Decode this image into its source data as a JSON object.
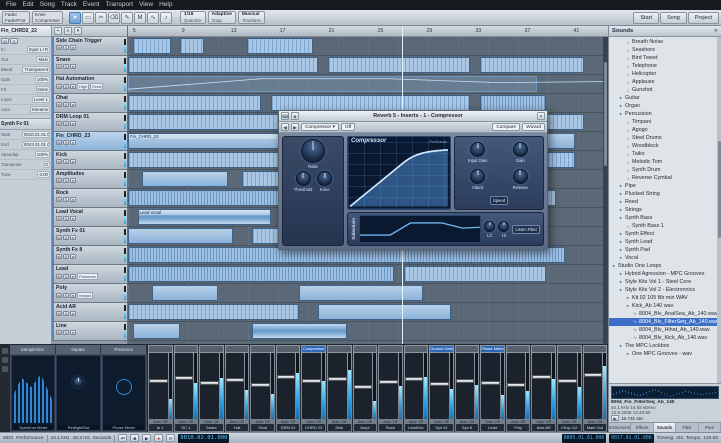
{
  "menubar": {
    "items": [
      "File",
      "Edit",
      "Song",
      "Track",
      "Event",
      "Transport",
      "View",
      "Help"
    ]
  },
  "linkboxes": [
    {
      "line1": "Fader",
      "line2": "FaderPort"
    },
    {
      "line1": "Knee",
      "line2": "Compressor"
    }
  ],
  "toolbar": {
    "tools": [
      {
        "name": "arrow-tool",
        "glyph": "➤"
      },
      {
        "name": "range-tool",
        "glyph": "▭"
      },
      {
        "name": "split-tool",
        "glyph": "✂"
      },
      {
        "name": "eraser-tool",
        "glyph": "⌫"
      },
      {
        "name": "paint-tool",
        "glyph": "✎"
      },
      {
        "name": "mute-tool",
        "glyph": "M"
      },
      {
        "name": "bend-tool",
        "glyph": "∿"
      },
      {
        "name": "listen-tool",
        "glyph": "♪"
      }
    ],
    "boxes": [
      {
        "top": "1/16",
        "bottom": "Quantize"
      },
      {
        "top": "Adaptive",
        "bottom": "Snap"
      },
      {
        "top": "Musical",
        "bottom": "Timebase"
      }
    ],
    "right_buttons": [
      "Start",
      "Song",
      "Project"
    ]
  },
  "inspector": {
    "track_name": "Fin_CHRD2_22",
    "buttons": [
      "M",
      "S"
    ],
    "rows": [
      {
        "label": "In",
        "value": "Input L+R"
      },
      {
        "label": "Out",
        "value": "Main"
      },
      {
        "label": "Blend",
        "value": "Transparent"
      },
      {
        "label": "Gain",
        "value": "100%"
      },
      {
        "label": "FX",
        "value": "None"
      },
      {
        "label": "Layer",
        "value": "Level 1"
      },
      {
        "label": "Auto",
        "value": "Streams"
      }
    ],
    "section2": {
      "title": "Synth Fx 01",
      "rows": [
        {
          "label": "Start",
          "value": "0010.01.01.000"
        },
        {
          "label": "End",
          "value": "0043.01.01.000"
        },
        {
          "label": "Speedup",
          "value": "100%"
        },
        {
          "label": "Transpose",
          "value": "0"
        },
        {
          "label": "Tune",
          "value": "0.00"
        }
      ]
    }
  },
  "tracks": [
    {
      "name": "Side Chain Trigger"
    },
    {
      "name": "Snare"
    },
    {
      "name": "Hat Automation",
      "chips": [
        "High",
        "Feed"
      ]
    },
    {
      "name": "Ohat"
    },
    {
      "name": "DRM Loop 01"
    },
    {
      "name": "Fin_CHRD_23",
      "selected": true
    },
    {
      "name": "Kick"
    },
    {
      "name": "Amplitudes"
    },
    {
      "name": "Rock"
    },
    {
      "name": "Lead Vocal"
    },
    {
      "name": "Synth Fx 01"
    },
    {
      "name": "Synth Fx 8"
    },
    {
      "name": "Lead",
      "sub": "Presence"
    },
    {
      "name": "Poly",
      "sub": "Impact"
    },
    {
      "name": "Acid AR"
    },
    {
      "name": "Line"
    }
  ],
  "arrange": {
    "ruler": [
      "5",
      "9",
      "13",
      "17",
      "21",
      "25",
      "29",
      "33",
      "37",
      "41"
    ],
    "rows": [
      {
        "clips": [
          {
            "x": 1,
            "w": 8,
            "t": "steps"
          },
          {
            "x": 11,
            "w": 5,
            "t": "steps"
          },
          {
            "x": 25,
            "w": 14,
            "t": "steps"
          }
        ]
      },
      {
        "clips": [
          {
            "x": 0,
            "w": 40,
            "t": "steps"
          },
          {
            "x": 42,
            "w": 30,
            "t": "steps"
          },
          {
            "x": 74,
            "w": 22,
            "t": "steps"
          }
        ]
      },
      {
        "auto": true,
        "clips": [
          {
            "x": 0,
            "w": 86,
            "t": "ghost"
          }
        ]
      },
      {
        "clips": [
          {
            "x": 0,
            "w": 28,
            "t": "steps"
          },
          {
            "x": 30,
            "w": 42,
            "t": "steps"
          },
          {
            "x": 74,
            "w": 14,
            "t": "cells"
          }
        ]
      },
      {
        "clips": [
          {
            "x": 0,
            "w": 96,
            "t": "steps"
          }
        ]
      },
      {
        "clips": [
          {
            "x": 0,
            "w": 58,
            "t": "solid",
            "label": "Fin_CHRD_23"
          },
          {
            "x": 60,
            "w": 34,
            "t": "solid"
          }
        ]
      },
      {
        "clips": [
          {
            "x": 0,
            "w": 42,
            "t": "steps"
          },
          {
            "x": 46,
            "w": 48,
            "t": "steps"
          }
        ]
      },
      {
        "clips": [
          {
            "x": 3,
            "w": 18,
            "t": "solid"
          },
          {
            "x": 24,
            "w": 30,
            "t": "steps"
          },
          {
            "x": 58,
            "w": 20,
            "t": "solid"
          }
        ]
      },
      {
        "clips": [
          {
            "x": 0,
            "w": 48,
            "t": "cells"
          },
          {
            "x": 50,
            "w": 40,
            "t": "steps"
          }
        ]
      },
      {
        "clips": [
          {
            "x": 2,
            "w": 28,
            "t": "wave",
            "label": "Lead Vocal"
          },
          {
            "x": 38,
            "w": 38,
            "t": "wave"
          }
        ]
      },
      {
        "clips": [
          {
            "x": 0,
            "w": 22,
            "t": "solid"
          },
          {
            "x": 26,
            "w": 48,
            "t": "steps"
          }
        ]
      },
      {
        "clips": [
          {
            "x": 0,
            "w": 92,
            "t": "cells"
          }
        ]
      },
      {
        "clips": [
          {
            "x": 0,
            "w": 56,
            "t": "cells"
          },
          {
            "x": 58,
            "w": 30,
            "t": "steps"
          }
        ]
      },
      {
        "clips": [
          {
            "x": 5,
            "w": 14,
            "t": "solid"
          },
          {
            "x": 36,
            "w": 26,
            "t": "solid"
          }
        ]
      },
      {
        "clips": [
          {
            "x": 0,
            "w": 36,
            "t": "steps"
          },
          {
            "x": 40,
            "w": 28,
            "t": "solid"
          }
        ]
      },
      {
        "clips": [
          {
            "x": 1,
            "w": 10,
            "t": "solid"
          },
          {
            "x": 26,
            "w": 20,
            "t": "wave"
          }
        ]
      }
    ]
  },
  "plugin": {
    "title": "Reverb 5 - Inserts - 1 - Compressor",
    "preset": "Compressor",
    "bypass": "Off",
    "compare": "Compare",
    "wizard": "Wizard",
    "name": "Compressor",
    "brand": "PreSonus",
    "ratio_label": "Ratio",
    "threshold_label": "Threshold",
    "knee_label": "Knee",
    "input_gain_label": "Input Gain",
    "gain_label": "Gain",
    "attack_label": "Attack",
    "release_label": "Release",
    "speed_label": "Speed",
    "sidechain_label": "Sidechain",
    "lc_label": "LC",
    "hi_label": "HI",
    "listen_label": "Listen Filter"
  },
  "browser": {
    "header": "Sounds",
    "items": [
      {
        "label": "Breath Noise",
        "level": 2,
        "icon": "sound"
      },
      {
        "label": "Seashore",
        "level": 2,
        "icon": "sound"
      },
      {
        "label": "Bird Tweet",
        "level": 2,
        "icon": "sound"
      },
      {
        "label": "Telephone",
        "level": 2,
        "icon": "sound"
      },
      {
        "label": "Helicopter",
        "level": 2,
        "icon": "sound"
      },
      {
        "label": "Applause",
        "level": 2,
        "icon": "sound"
      },
      {
        "label": "Gunshot",
        "level": 2,
        "icon": "sound"
      },
      {
        "label": "Guitar",
        "level": 1,
        "icon": "folder"
      },
      {
        "label": "Organ",
        "level": 1,
        "icon": "folder"
      },
      {
        "label": "Percussion",
        "level": 1,
        "icon": "folder"
      },
      {
        "label": "Timpani",
        "level": 2,
        "icon": "sound"
      },
      {
        "label": "Agogo",
        "level": 2,
        "icon": "sound"
      },
      {
        "label": "Steel Drums",
        "level": 2,
        "icon": "sound"
      },
      {
        "label": "Woodblock",
        "level": 2,
        "icon": "sound"
      },
      {
        "label": "Taiko",
        "level": 2,
        "icon": "sound"
      },
      {
        "label": "Melodic Tom",
        "level": 2,
        "icon": "sound"
      },
      {
        "label": "Synth Drum",
        "level": 2,
        "icon": "sound"
      },
      {
        "label": "Reverse Cymbal",
        "level": 2,
        "icon": "sound"
      },
      {
        "label": "Pipe",
        "level": 1,
        "icon": "folder"
      },
      {
        "label": "Plucked String",
        "level": 1,
        "icon": "folder"
      },
      {
        "label": "Reed",
        "level": 1,
        "icon": "folder"
      },
      {
        "label": "Strings",
        "level": 1,
        "icon": "folder"
      },
      {
        "label": "Synth Bass",
        "level": 1,
        "icon": "folder"
      },
      {
        "label": "Synth Bass 1",
        "level": 2,
        "icon": "sound"
      },
      {
        "label": "Synth Effect",
        "level": 1,
        "icon": "folder"
      },
      {
        "label": "Synth Lead",
        "level": 1,
        "icon": "folder"
      },
      {
        "label": "Synth Pad",
        "level": 1,
        "icon": "folder"
      },
      {
        "label": "Vocal",
        "level": 1,
        "icon": "folder"
      },
      {
        "label": "Studio One Loops",
        "level": 0,
        "icon": "folder"
      },
      {
        "label": "Hybrid Agression - MPC Grooves",
        "level": 1,
        "icon": "folder"
      },
      {
        "label": "Style Kits Vol 1 - Steel Core",
        "level": 1,
        "icon": "folder"
      },
      {
        "label": "Style Kits Vol 2 - Electronnics",
        "level": 1,
        "icon": "folder"
      },
      {
        "label": "Kit 02 105 Bb min WAV",
        "level": 2,
        "icon": "folder"
      },
      {
        "label": "Kick_Ab 140 wav",
        "level": 2,
        "icon": "folder"
      },
      {
        "label": "8004_Blv_AnalSea_Ab_140.wav",
        "level": 3,
        "icon": "wav"
      },
      {
        "label": "8004_Blv_FilterSeq_Ab_140.wav",
        "level": 3,
        "icon": "wav",
        "selected": true
      },
      {
        "label": "8004_Blv_Hihat_Ab_140.wav",
        "level": 3,
        "icon": "wav"
      },
      {
        "label": "8004_Blv_Kick_Ab_140.wav",
        "level": 3,
        "icon": "wav"
      },
      {
        "label": "The MPC Lockbox",
        "level": 1,
        "icon": "folder"
      },
      {
        "label": "One MPC Grooves - wav",
        "level": 2,
        "icon": "folder"
      }
    ],
    "preview": {
      "name": "8004_Fin_FilterSeq_Ab_140",
      "format": "44.1 kHz 16 bit stereo",
      "date": "13.9.2008 13:43:55",
      "length": "15.731 sec"
    },
    "tabs": [
      "Instruments",
      "Effects",
      "Sounds",
      "Files",
      "Pool"
    ],
    "active_tab": 2
  },
  "mixer": {
    "rack_tabs": [
      "SampleOne",
      "Impact",
      "Presence"
    ],
    "displays": [
      "Spectrum Meter",
      "RedlightDist",
      "Phase Meter"
    ],
    "channels": [
      {
        "name": "In 1",
        "auto": "Auto: Off",
        "fader": 40,
        "lvl": 30
      },
      {
        "name": "SC 1",
        "auto": "Auto: Off",
        "fader": 35,
        "lvl": 55
      },
      {
        "name": "Snare",
        "auto": "Auto: Off",
        "fader": 42,
        "lvl": 62
      },
      {
        "name": "Hat",
        "auto": "Auto: Off",
        "fader": 38,
        "lvl": 44
      },
      {
        "name": "Ohat",
        "auto": "Auto: Off",
        "fader": 45,
        "lvl": 38
      },
      {
        "name": "DRM 01",
        "auto": "Auto: Off",
        "fader": 33,
        "lvl": 70
      },
      {
        "name": "CHRD 23",
        "auto": "Auto: Off",
        "fader": 40,
        "lvl": 58,
        "chip": "Compressor"
      },
      {
        "name": "Kick",
        "auto": "Auto: Off",
        "fader": 36,
        "lvl": 75
      },
      {
        "name": "Ampl",
        "auto": "Auto: Off",
        "fader": 48,
        "lvl": 28
      },
      {
        "name": "Rock",
        "auto": "Auto: Off",
        "fader": 41,
        "lvl": 50
      },
      {
        "name": "LeadVoc",
        "auto": "Auto: Off",
        "fader": 37,
        "lvl": 64
      },
      {
        "name": "Syn 01",
        "auto": "Auto: Off",
        "fader": 44,
        "lvl": 46,
        "chip": "Groove Delay"
      },
      {
        "name": "Syn 8",
        "auto": "Auto: Off",
        "fader": 39,
        "lvl": 52
      },
      {
        "name": "Lead",
        "auto": "Auto: Off",
        "fader": 43,
        "lvl": 36,
        "chip": "Phase Meter"
      },
      {
        "name": "Poly",
        "auto": "Auto: Off",
        "fader": 46,
        "lvl": 42
      },
      {
        "name": "Acid AR",
        "auto": "Auto: Off",
        "fader": 34,
        "lvl": 60
      },
      {
        "name": "Chop 1/2",
        "auto": "Auto: Off",
        "fader": 40,
        "lvl": 48
      },
      {
        "name": "Main Out",
        "auto": "Auto: Off",
        "fader": 30,
        "lvl": 80
      }
    ]
  },
  "statusbar": {
    "midi": "MIDI",
    "perf": "Performance",
    "rate": "44.1 kHz",
    "latency": "48.3 ms",
    "unit": "Seconds",
    "pos": "0010.02.01.000",
    "sel_start": "0005.01.01.000",
    "sel_end": "0017.01.01.000",
    "timesig_label": "Timesig",
    "timesig": "4/4",
    "tempo_label": "Tempo",
    "tempo": "140.00"
  }
}
